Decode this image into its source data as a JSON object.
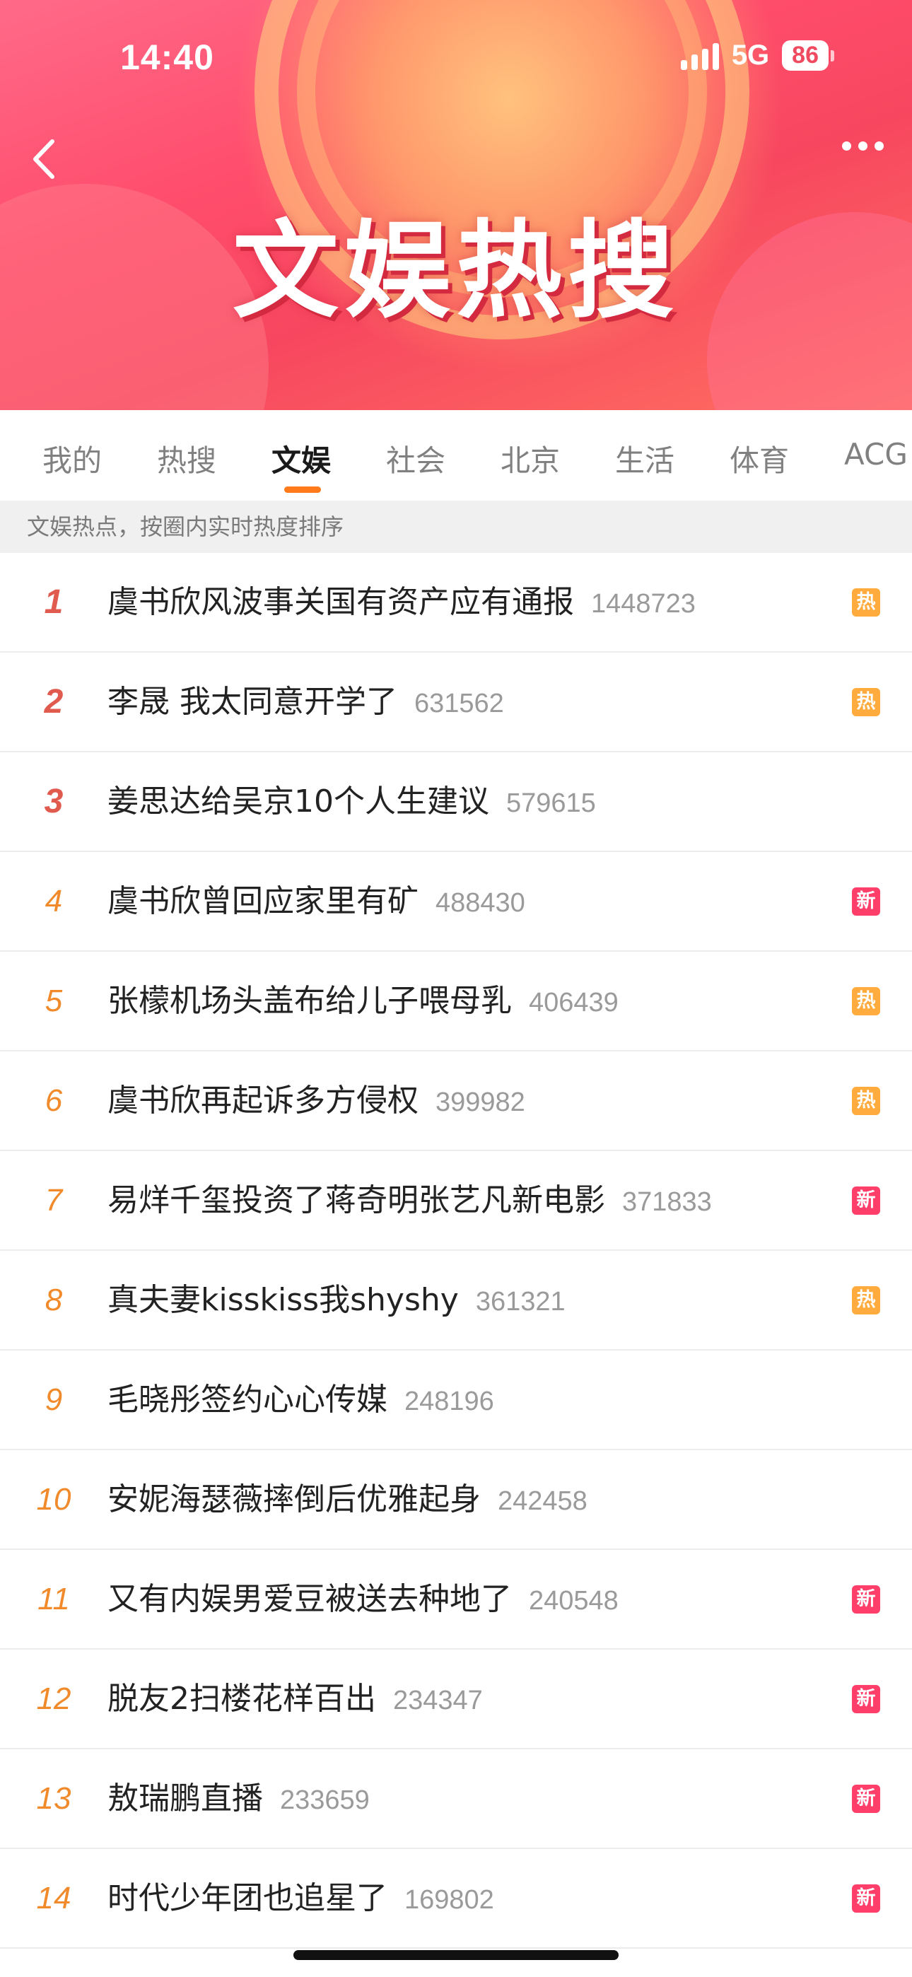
{
  "status_bar": {
    "time": "14:40",
    "network": "5G",
    "battery": "86"
  },
  "banner": {
    "title": "文娱热搜"
  },
  "tabs": [
    {
      "label": "我的"
    },
    {
      "label": "热搜"
    },
    {
      "label": "文娱",
      "active": true
    },
    {
      "label": "社会"
    },
    {
      "label": "北京"
    },
    {
      "label": "生活"
    },
    {
      "label": "体育"
    },
    {
      "label": "ACG"
    }
  ],
  "subheader": "文娱热点，按圈内实时热度排序",
  "items": [
    {
      "rank": "1",
      "title": "虞书欣风波事关国有资产应有通报",
      "count": "1448723",
      "badge": "热",
      "badge_type": "hot"
    },
    {
      "rank": "2",
      "title": "李晟 我太同意开学了",
      "count": "631562",
      "badge": "热",
      "badge_type": "hot"
    },
    {
      "rank": "3",
      "title": "姜思达给吴京10个人生建议",
      "count": "579615",
      "badge": "",
      "badge_type": ""
    },
    {
      "rank": "4",
      "title": "虞书欣曾回应家里有矿",
      "count": "488430",
      "badge": "新",
      "badge_type": "new"
    },
    {
      "rank": "5",
      "title": "张檬机场头盖布给儿子喂母乳",
      "count": "406439",
      "badge": "热",
      "badge_type": "hot"
    },
    {
      "rank": "6",
      "title": "虞书欣再起诉多方侵权",
      "count": "399982",
      "badge": "热",
      "badge_type": "hot"
    },
    {
      "rank": "7",
      "title": "易烊千玺投资了蒋奇明张艺凡新电影",
      "count": "371833",
      "badge": "新",
      "badge_type": "new"
    },
    {
      "rank": "8",
      "title": "真夫妻kisskiss我shyshy",
      "count": "361321",
      "badge": "热",
      "badge_type": "hot"
    },
    {
      "rank": "9",
      "title": "毛晓彤签约心心传媒",
      "count": "248196",
      "badge": "",
      "badge_type": ""
    },
    {
      "rank": "10",
      "title": "安妮海瑟薇摔倒后优雅起身",
      "count": "242458",
      "badge": "",
      "badge_type": ""
    },
    {
      "rank": "11",
      "title": "又有内娱男爱豆被送去种地了",
      "count": "240548",
      "badge": "新",
      "badge_type": "new"
    },
    {
      "rank": "12",
      "title": "脱友2扫楼花样百出",
      "count": "234347",
      "badge": "新",
      "badge_type": "new"
    },
    {
      "rank": "13",
      "title": "敖瑞鹏直播",
      "count": "233659",
      "badge": "新",
      "badge_type": "new"
    },
    {
      "rank": "14",
      "title": "时代少年团也追星了",
      "count": "169802",
      "badge": "新",
      "badge_type": "new"
    }
  ],
  "colors": {
    "accent": "#ff7a1a",
    "hot_badge": "#ffab3d",
    "new_badge": "#ff3e6a",
    "rank_top": "#e05a4e",
    "rank": "#f08a2a"
  }
}
